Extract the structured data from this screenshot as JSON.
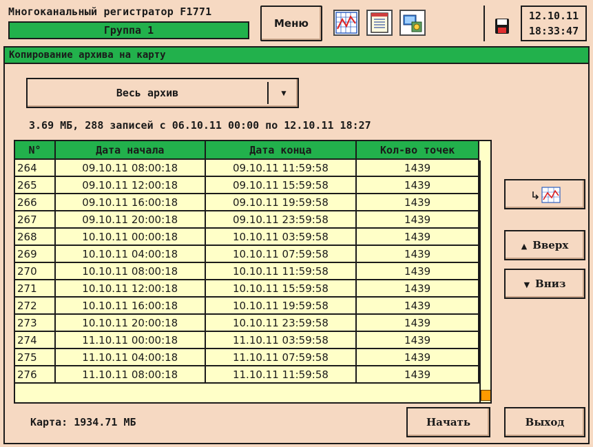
{
  "header": {
    "app_title": "Многоканальный регистратор F1771",
    "group": "Группа 1",
    "menu_label": "Меню",
    "date": "12.10.11",
    "time": "18:33:47",
    "icons": [
      "chart-icon",
      "notepad-icon",
      "settings-icon",
      "floppy-disk-icon"
    ]
  },
  "panel": {
    "title": "Копирование архива на карту",
    "select_value": "Весь архив",
    "summary": "3.69 МБ, 288 записей с 06.10.11 00:00 по 12.10.11 18:27",
    "card_info": "Карта: 1934.71 МБ"
  },
  "table": {
    "columns": [
      "N°",
      "Дата начала",
      "Дата конца",
      "Кол-во точек"
    ],
    "rows": [
      [
        "264",
        "09.10.11 08:00:18",
        "09.10.11 11:59:58",
        "1439"
      ],
      [
        "265",
        "09.10.11 12:00:18",
        "09.10.11 15:59:58",
        "1439"
      ],
      [
        "266",
        "09.10.11 16:00:18",
        "09.10.11 19:59:58",
        "1439"
      ],
      [
        "267",
        "09.10.11 20:00:18",
        "09.10.11 23:59:58",
        "1439"
      ],
      [
        "268",
        "10.10.11 00:00:18",
        "10.10.11 03:59:58",
        "1439"
      ],
      [
        "269",
        "10.10.11 04:00:18",
        "10.10.11 07:59:58",
        "1439"
      ],
      [
        "270",
        "10.10.11 08:00:18",
        "10.10.11 11:59:58",
        "1439"
      ],
      [
        "271",
        "10.10.11 12:00:18",
        "10.10.11 15:59:58",
        "1439"
      ],
      [
        "272",
        "10.10.11 16:00:18",
        "10.10.11 19:59:58",
        "1439"
      ],
      [
        "273",
        "10.10.11 20:00:18",
        "10.10.11 23:59:58",
        "1439"
      ],
      [
        "274",
        "11.10.11 00:00:18",
        "11.10.11 03:59:58",
        "1439"
      ],
      [
        "275",
        "11.10.11 04:00:18",
        "11.10.11 07:59:58",
        "1439"
      ],
      [
        "276",
        "11.10.11 08:00:18",
        "11.10.11 11:59:58",
        "1439"
      ]
    ],
    "scroll_fraction": 1.0
  },
  "buttons": {
    "up_label": "Вверх",
    "down_label": "Вниз",
    "start_label": "Начать",
    "exit_label": "Выход"
  },
  "colors": {
    "background": "#f6d9c2",
    "accent_green": "#22b14c",
    "table_bg": "#ffffc8",
    "scroll_thumb": "#ff9a00"
  }
}
